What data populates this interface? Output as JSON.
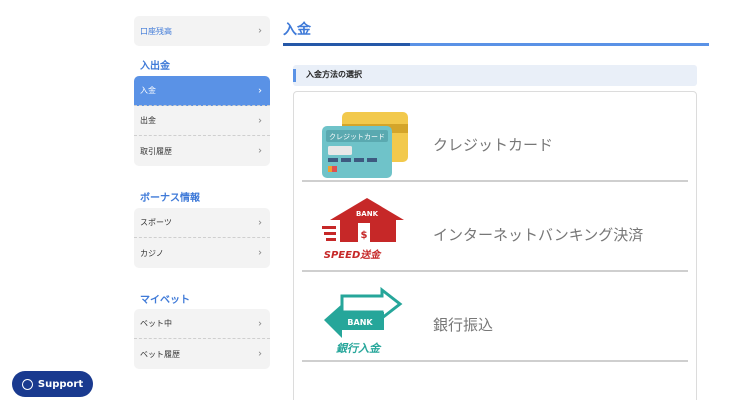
{
  "sidebar": {
    "top_item": "口座残高",
    "group1": {
      "heading": "入出金",
      "items": [
        "入金",
        "出金",
        "取引履歴"
      ]
    },
    "group2": {
      "heading": "ボーナス情報",
      "items": [
        "スポーツ",
        "カジノ"
      ]
    },
    "group3": {
      "heading": "マイベット",
      "items": [
        "ベット中",
        "ベット履歴"
      ]
    }
  },
  "main": {
    "title": "入金",
    "section_label": "入金方法の選択",
    "methods": [
      {
        "label": "クレジットカード",
        "icon": "credit-card-icon",
        "icon_text": "クレジットカード"
      },
      {
        "label": "インターネットバンキング決済",
        "icon": "speed-bank-icon",
        "icon_text": "BANK",
        "icon_text2": "SPEED送金"
      },
      {
        "label": "銀行振込",
        "icon": "bank-transfer-icon",
        "icon_text": "BANK",
        "icon_text2": "銀行入金"
      }
    ]
  },
  "support": {
    "label": "Support",
    "icon": "chat-bubble-icon"
  },
  "colors": {
    "accent": "#5a92e6",
    "accent_dark": "#2558a8",
    "support_bg": "#1a3a8f",
    "bank_red": "#c62828",
    "bank_teal": "#26a69a"
  }
}
